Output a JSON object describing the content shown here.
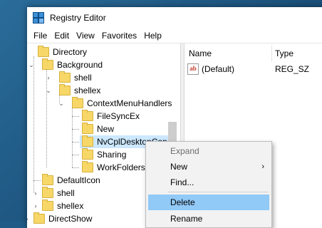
{
  "window": {
    "title": "Registry Editor"
  },
  "menu": [
    "File",
    "Edit",
    "View",
    "Favorites",
    "Help"
  ],
  "tree": [
    {
      "label": "Directory",
      "indent": 0,
      "chevron": ""
    },
    {
      "label": "Background",
      "indent": 1,
      "chevron": "v"
    },
    {
      "label": "shell",
      "indent": 2,
      "chevron": ">"
    },
    {
      "label": "shellex",
      "indent": 2,
      "chevron": "v"
    },
    {
      "label": "ContextMenuHandlers",
      "indent": 3,
      "chevron": "v"
    },
    {
      "label": "FileSyncEx",
      "indent": 4,
      "chevron": ""
    },
    {
      "label": "New",
      "indent": 4,
      "chevron": ""
    },
    {
      "label": "NvCplDesktopCon",
      "indent": 4,
      "chevron": "",
      "selected": true
    },
    {
      "label": "Sharing",
      "indent": 4,
      "chevron": ""
    },
    {
      "label": "WorkFolders",
      "indent": 4,
      "chevron": ""
    },
    {
      "label": "DefaultIcon",
      "indent": 1,
      "chevron": ""
    },
    {
      "label": "shell",
      "indent": 1,
      "chevron": ">"
    },
    {
      "label": "shellex",
      "indent": 1,
      "chevron": ">"
    },
    {
      "label": "DirectShow",
      "indent": 0,
      "chevron": ">"
    }
  ],
  "list": {
    "columns": [
      "Name",
      "Type"
    ],
    "rows": [
      {
        "name": "(Default)",
        "type": "REG_SZ",
        "icon": "string-value-icon"
      }
    ]
  },
  "context_menu": {
    "items": [
      {
        "label": "Expand",
        "disabled": true
      },
      {
        "label": "New",
        "submenu": true
      },
      {
        "label": "Find..."
      },
      {
        "label": "Delete",
        "highlighted": true
      },
      {
        "label": "Rename"
      }
    ]
  }
}
